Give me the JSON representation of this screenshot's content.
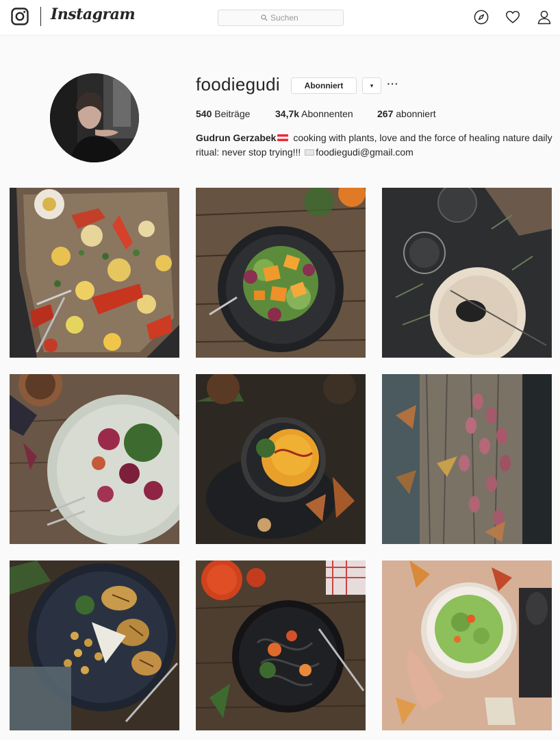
{
  "header": {
    "wordmark": "Instagram",
    "search_placeholder": "Suchen"
  },
  "profile": {
    "username": "foodiegudi",
    "follow_label": "Abonniert",
    "dropdown_label": "▾",
    "more_label": "···",
    "stats": {
      "posts_count": "540",
      "posts_label": "Beiträge",
      "followers_count": "34,7k",
      "followers_label": "Abonnenten",
      "following_count": "267",
      "following_label": "abonniert"
    },
    "bio": {
      "full_name": "Gudrun Gerzabek",
      "text_line": "cooking with plants, love and the force of healing nature daily ritual: never stop trying!!!",
      "email": "foodiegudi@gmail.com"
    }
  },
  "posts": [
    {
      "name": "roasted-vegetables-post"
    },
    {
      "name": "pumpkin-salad-post"
    },
    {
      "name": "dark-tea-plate-post"
    },
    {
      "name": "beet-salad-post"
    },
    {
      "name": "pumpkin-soup-post"
    },
    {
      "name": "almonds-wood-post"
    },
    {
      "name": "grilled-eggplant-post"
    },
    {
      "name": "black-pasta-post"
    },
    {
      "name": "green-soup-post"
    }
  ],
  "colors": {
    "background": "#fafafa",
    "nav_background": "#ffffff",
    "text": "#262626",
    "border": "#dbdbdb"
  }
}
